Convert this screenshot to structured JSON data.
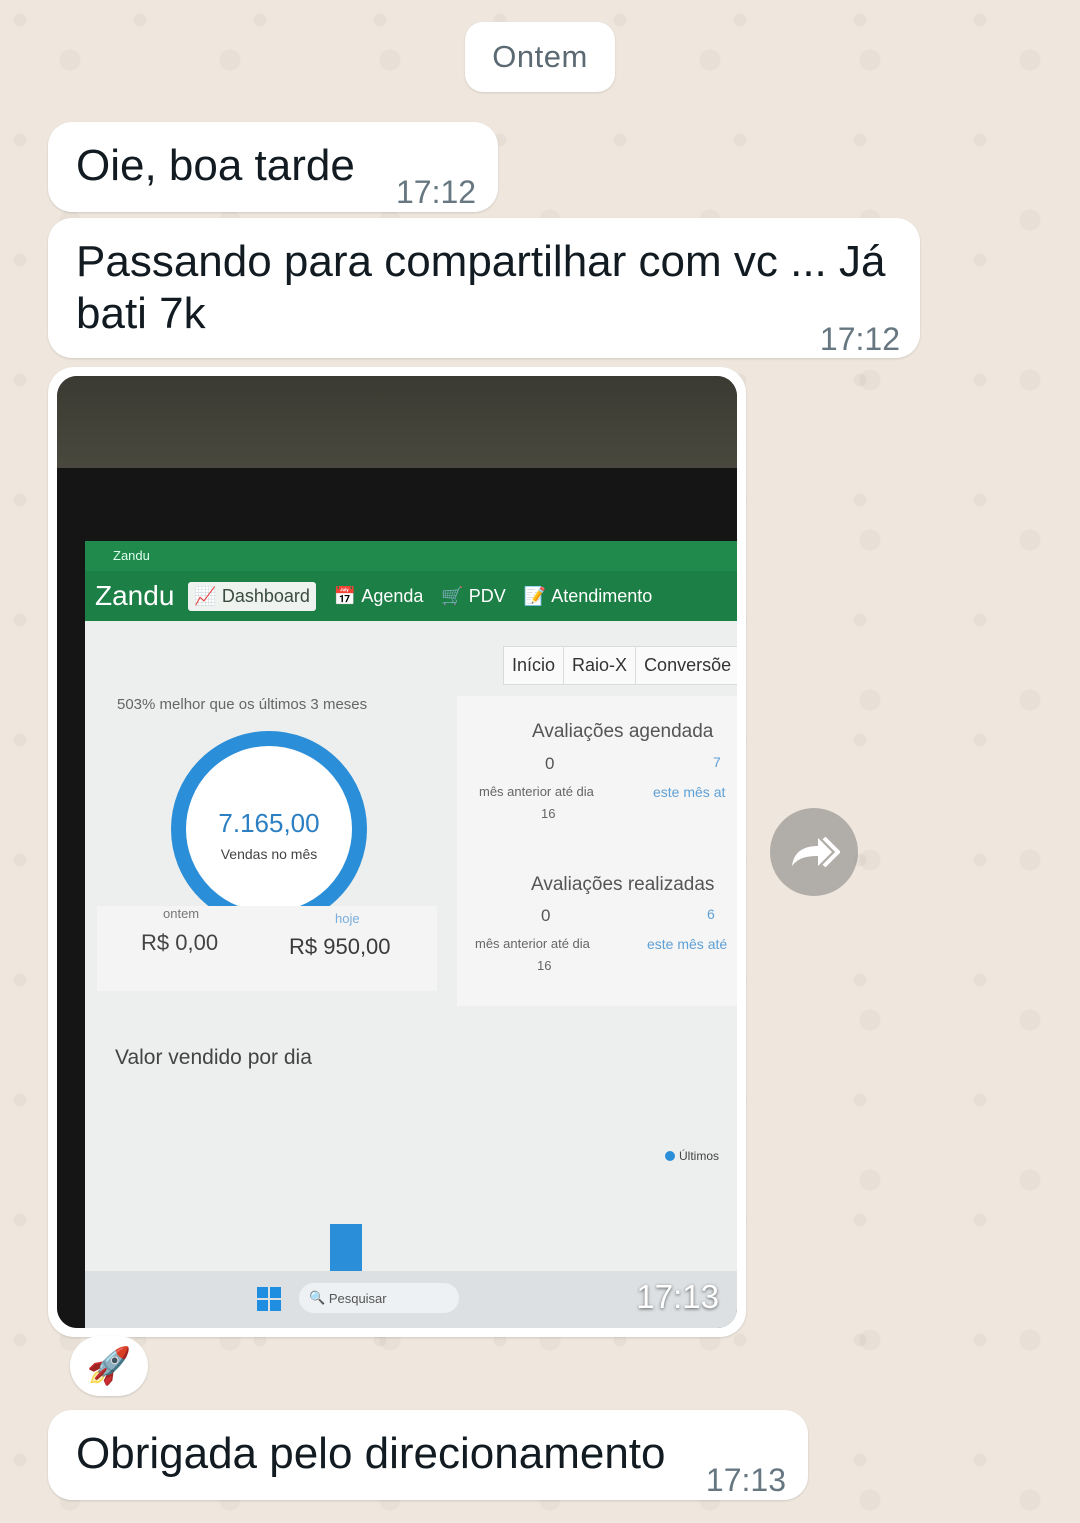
{
  "date_chip": "Ontem",
  "messages": [
    {
      "text": "Oie,  boa tarde",
      "time": "17:12"
    },
    {
      "text": "Passando para compartilhar com vc ... Já bati 7k",
      "time": "17:12"
    },
    {
      "time": "17:13"
    },
    {
      "text": "Obrigada pelo direcionamento",
      "time": "17:13"
    }
  ],
  "reaction": "🚀",
  "photo_screen": {
    "window_title": "Zandu",
    "logo": "Zandu",
    "nav": [
      "Dashboard",
      "Agenda",
      "PDV",
      "Atendimento"
    ],
    "tabs": [
      "Início",
      "Raio-X",
      "Conversõe"
    ],
    "comparison": "503% melhor que os últimos 3 meses",
    "sales_month_value": "7.165,00",
    "sales_month_label": "Vendas no mês",
    "ontem_label": "ontem",
    "ontem_value": "R$ 0,00",
    "hoje_label": "hoje",
    "hoje_value": "R$ 950,00",
    "avaliacoes_agendadas": {
      "title": "Avaliações agendada",
      "prev_value": "0",
      "prev_label": "mês anterior até dia",
      "day": "16",
      "cur_value": "7",
      "cur_label": "este mês at"
    },
    "avaliacoes_realizadas": {
      "title": "Avaliações realizadas",
      "prev_value": "0",
      "prev_label": "mês anterior até dia",
      "day": "16",
      "cur_value": "6",
      "cur_label": "este mês até"
    },
    "chart_title": "Valor vendido por dia",
    "legend": "Últimos",
    "taskbar_search": "Pesquisar",
    "accent_color": "#2b8ed8",
    "nav_color": "#1c7f45"
  }
}
